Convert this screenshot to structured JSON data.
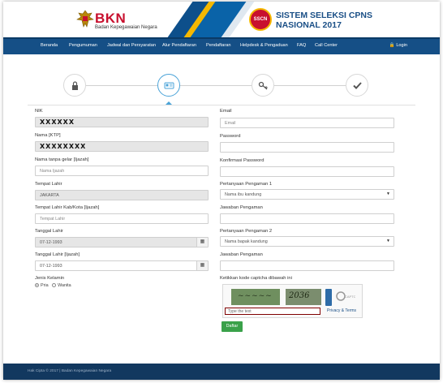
{
  "header": {
    "bkn_logo_text": "BKN",
    "bkn_subtitle": "Badan Kepegawaian Negara",
    "sscn_badge": "SSCN",
    "title_line1": "SISTEM SELEKSI CPNS",
    "title_line2": "NASIONAL 2017"
  },
  "nav": {
    "items": [
      "Beranda",
      "Pengumuman",
      "Jadwal dan Persyaratan",
      "Alur Pendaftaran",
      "Pendaftaran",
      "Helpdesk & Pengaduan",
      "FAQ",
      "Call Center"
    ],
    "login": "Login"
  },
  "stepper": {
    "steps": [
      "lock-icon",
      "id-card-icon",
      "key-icon",
      "check-icon"
    ],
    "active_index": 1
  },
  "form": {
    "nik": {
      "label": "NIK",
      "value": "XXXXXX"
    },
    "nama_ktp": {
      "label": "Nama [KTP]",
      "value": "XXXXXXXX"
    },
    "nama_ijazah": {
      "label": "Nama tanpa gelar [Ijazah]",
      "placeholder": "Nama Ijazah"
    },
    "tempat_lahir": {
      "label": "Tempat Lahir",
      "value": "JAKARTA"
    },
    "tempat_lahir_ijazah": {
      "label": "Tempat Lahir Kab/Kota [Ijazah]",
      "placeholder": "Tempat Lahir"
    },
    "tanggal_lahir": {
      "label": "Tanggal Lahir",
      "value": "07-12-1993"
    },
    "tanggal_lahir_ijazah": {
      "label": "Tanggal Lahir [Ijazah]",
      "value": "07-12-1993"
    },
    "jenis_kelamin": {
      "label": "Jenis Kelamin",
      "options": [
        "Pria",
        "Wanita"
      ],
      "selected": "Pria"
    },
    "email": {
      "label": "Email",
      "placeholder": "Email"
    },
    "password": {
      "label": "Password"
    },
    "konfirmasi_password": {
      "label": "Konfirmasi Password"
    },
    "pertanyaan1": {
      "label": "Pertanyaan Pengaman 1",
      "value": "Nama ibu kandung"
    },
    "jawaban1": {
      "label": "Jawaban Pengaman"
    },
    "pertanyaan2": {
      "label": "Pertanyaan Pengaman 2",
      "value": "Nama bapak kandung"
    },
    "jawaban2": {
      "label": "Jawaban Pengaman"
    },
    "captcha": {
      "label": "Ketikkan kode captcha dibawah ini",
      "placeholder": "Type the text",
      "privacy": "Privacy & Terms"
    },
    "submit": "Daftar"
  },
  "footer": {
    "text": "Hak Cipta © 2017 | Badan Kepegawaian Negara"
  },
  "colors": {
    "nav_bg": "#154f86",
    "brand_red": "#c8102e",
    "submit_green": "#3aa14a",
    "step_active": "#4aa3d8"
  }
}
